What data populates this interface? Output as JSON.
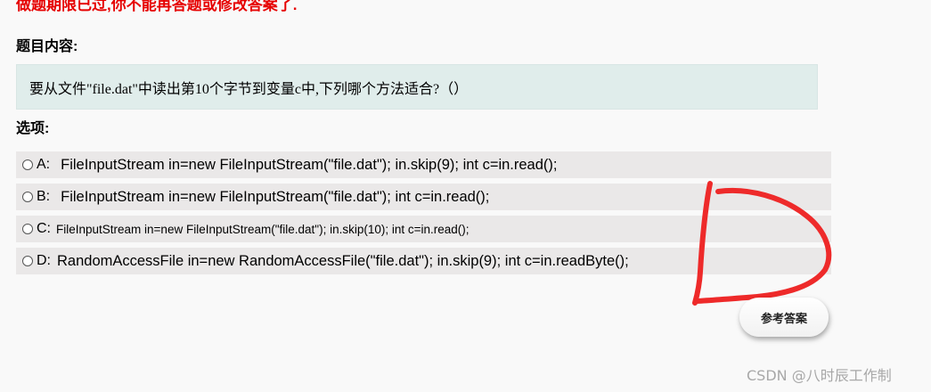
{
  "header": {
    "deadline_notice": "做题期限已过,你不能再答题或修改答案了."
  },
  "question": {
    "label": "题目内容:",
    "text": "要从文件\"file.dat\"中读出第10个字节到变量c中,下列哪个方法适合?（）"
  },
  "options": {
    "label": "选项:",
    "items": [
      {
        "letter": "A:",
        "text": "FileInputStream in=new FileInputStream(\"file.dat\"); in.skip(9); int c=in.read();"
      },
      {
        "letter": "B:",
        "text": "FileInputStream in=new FileInputStream(\"file.dat\"); int c=in.read();"
      },
      {
        "letter": "C:",
        "text": "FileInputStream in=new FileInputStream(\"file.dat\"); in.skip(10); int c=in.read();"
      },
      {
        "letter": "D:",
        "text": "RandomAccessFile in=new RandomAccessFile(\"file.dat\"); in.skip(9); int c=in.readByte();"
      }
    ]
  },
  "reference_answer_button": "参考答案",
  "annotation": {
    "handwritten_mark": "D",
    "color": "#ee2a2a"
  },
  "watermark": "CSDN @八时辰工作制"
}
